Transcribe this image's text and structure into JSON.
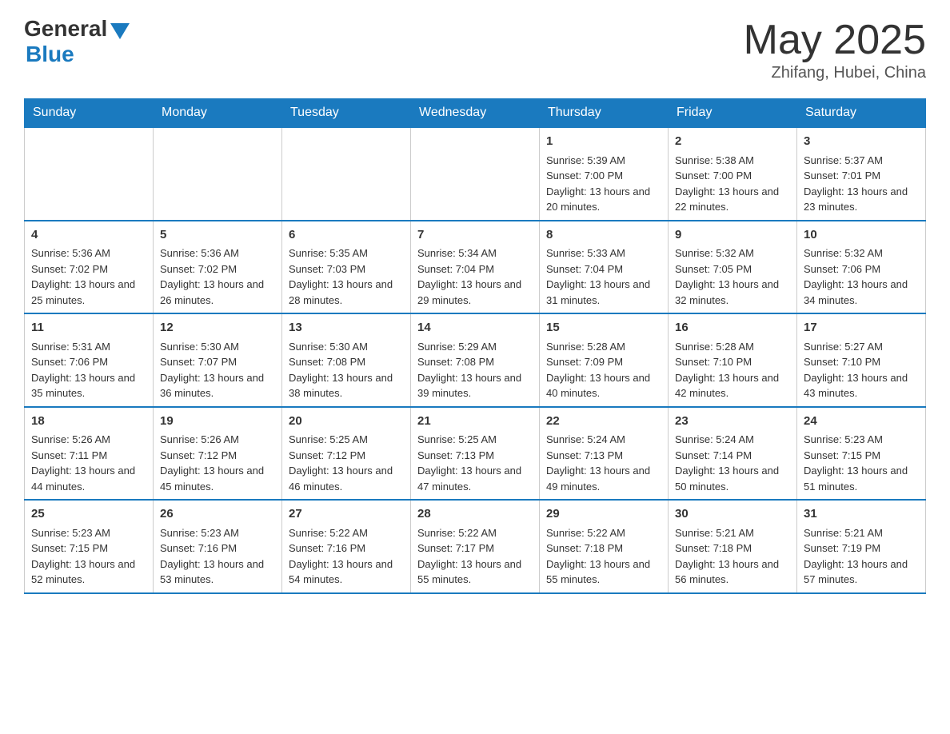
{
  "logo": {
    "general": "General",
    "blue": "Blue"
  },
  "title": "May 2025",
  "location": "Zhifang, Hubei, China",
  "weekdays": [
    "Sunday",
    "Monday",
    "Tuesday",
    "Wednesday",
    "Thursday",
    "Friday",
    "Saturday"
  ],
  "weeks": [
    [
      {
        "day": "",
        "info": ""
      },
      {
        "day": "",
        "info": ""
      },
      {
        "day": "",
        "info": ""
      },
      {
        "day": "",
        "info": ""
      },
      {
        "day": "1",
        "info": "Sunrise: 5:39 AM\nSunset: 7:00 PM\nDaylight: 13 hours and 20 minutes."
      },
      {
        "day": "2",
        "info": "Sunrise: 5:38 AM\nSunset: 7:00 PM\nDaylight: 13 hours and 22 minutes."
      },
      {
        "day": "3",
        "info": "Sunrise: 5:37 AM\nSunset: 7:01 PM\nDaylight: 13 hours and 23 minutes."
      }
    ],
    [
      {
        "day": "4",
        "info": "Sunrise: 5:36 AM\nSunset: 7:02 PM\nDaylight: 13 hours and 25 minutes."
      },
      {
        "day": "5",
        "info": "Sunrise: 5:36 AM\nSunset: 7:02 PM\nDaylight: 13 hours and 26 minutes."
      },
      {
        "day": "6",
        "info": "Sunrise: 5:35 AM\nSunset: 7:03 PM\nDaylight: 13 hours and 28 minutes."
      },
      {
        "day": "7",
        "info": "Sunrise: 5:34 AM\nSunset: 7:04 PM\nDaylight: 13 hours and 29 minutes."
      },
      {
        "day": "8",
        "info": "Sunrise: 5:33 AM\nSunset: 7:04 PM\nDaylight: 13 hours and 31 minutes."
      },
      {
        "day": "9",
        "info": "Sunrise: 5:32 AM\nSunset: 7:05 PM\nDaylight: 13 hours and 32 minutes."
      },
      {
        "day": "10",
        "info": "Sunrise: 5:32 AM\nSunset: 7:06 PM\nDaylight: 13 hours and 34 minutes."
      }
    ],
    [
      {
        "day": "11",
        "info": "Sunrise: 5:31 AM\nSunset: 7:06 PM\nDaylight: 13 hours and 35 minutes."
      },
      {
        "day": "12",
        "info": "Sunrise: 5:30 AM\nSunset: 7:07 PM\nDaylight: 13 hours and 36 minutes."
      },
      {
        "day": "13",
        "info": "Sunrise: 5:30 AM\nSunset: 7:08 PM\nDaylight: 13 hours and 38 minutes."
      },
      {
        "day": "14",
        "info": "Sunrise: 5:29 AM\nSunset: 7:08 PM\nDaylight: 13 hours and 39 minutes."
      },
      {
        "day": "15",
        "info": "Sunrise: 5:28 AM\nSunset: 7:09 PM\nDaylight: 13 hours and 40 minutes."
      },
      {
        "day": "16",
        "info": "Sunrise: 5:28 AM\nSunset: 7:10 PM\nDaylight: 13 hours and 42 minutes."
      },
      {
        "day": "17",
        "info": "Sunrise: 5:27 AM\nSunset: 7:10 PM\nDaylight: 13 hours and 43 minutes."
      }
    ],
    [
      {
        "day": "18",
        "info": "Sunrise: 5:26 AM\nSunset: 7:11 PM\nDaylight: 13 hours and 44 minutes."
      },
      {
        "day": "19",
        "info": "Sunrise: 5:26 AM\nSunset: 7:12 PM\nDaylight: 13 hours and 45 minutes."
      },
      {
        "day": "20",
        "info": "Sunrise: 5:25 AM\nSunset: 7:12 PM\nDaylight: 13 hours and 46 minutes."
      },
      {
        "day": "21",
        "info": "Sunrise: 5:25 AM\nSunset: 7:13 PM\nDaylight: 13 hours and 47 minutes."
      },
      {
        "day": "22",
        "info": "Sunrise: 5:24 AM\nSunset: 7:13 PM\nDaylight: 13 hours and 49 minutes."
      },
      {
        "day": "23",
        "info": "Sunrise: 5:24 AM\nSunset: 7:14 PM\nDaylight: 13 hours and 50 minutes."
      },
      {
        "day": "24",
        "info": "Sunrise: 5:23 AM\nSunset: 7:15 PM\nDaylight: 13 hours and 51 minutes."
      }
    ],
    [
      {
        "day": "25",
        "info": "Sunrise: 5:23 AM\nSunset: 7:15 PM\nDaylight: 13 hours and 52 minutes."
      },
      {
        "day": "26",
        "info": "Sunrise: 5:23 AM\nSunset: 7:16 PM\nDaylight: 13 hours and 53 minutes."
      },
      {
        "day": "27",
        "info": "Sunrise: 5:22 AM\nSunset: 7:16 PM\nDaylight: 13 hours and 54 minutes."
      },
      {
        "day": "28",
        "info": "Sunrise: 5:22 AM\nSunset: 7:17 PM\nDaylight: 13 hours and 55 minutes."
      },
      {
        "day": "29",
        "info": "Sunrise: 5:22 AM\nSunset: 7:18 PM\nDaylight: 13 hours and 55 minutes."
      },
      {
        "day": "30",
        "info": "Sunrise: 5:21 AM\nSunset: 7:18 PM\nDaylight: 13 hours and 56 minutes."
      },
      {
        "day": "31",
        "info": "Sunrise: 5:21 AM\nSunset: 7:19 PM\nDaylight: 13 hours and 57 minutes."
      }
    ]
  ]
}
